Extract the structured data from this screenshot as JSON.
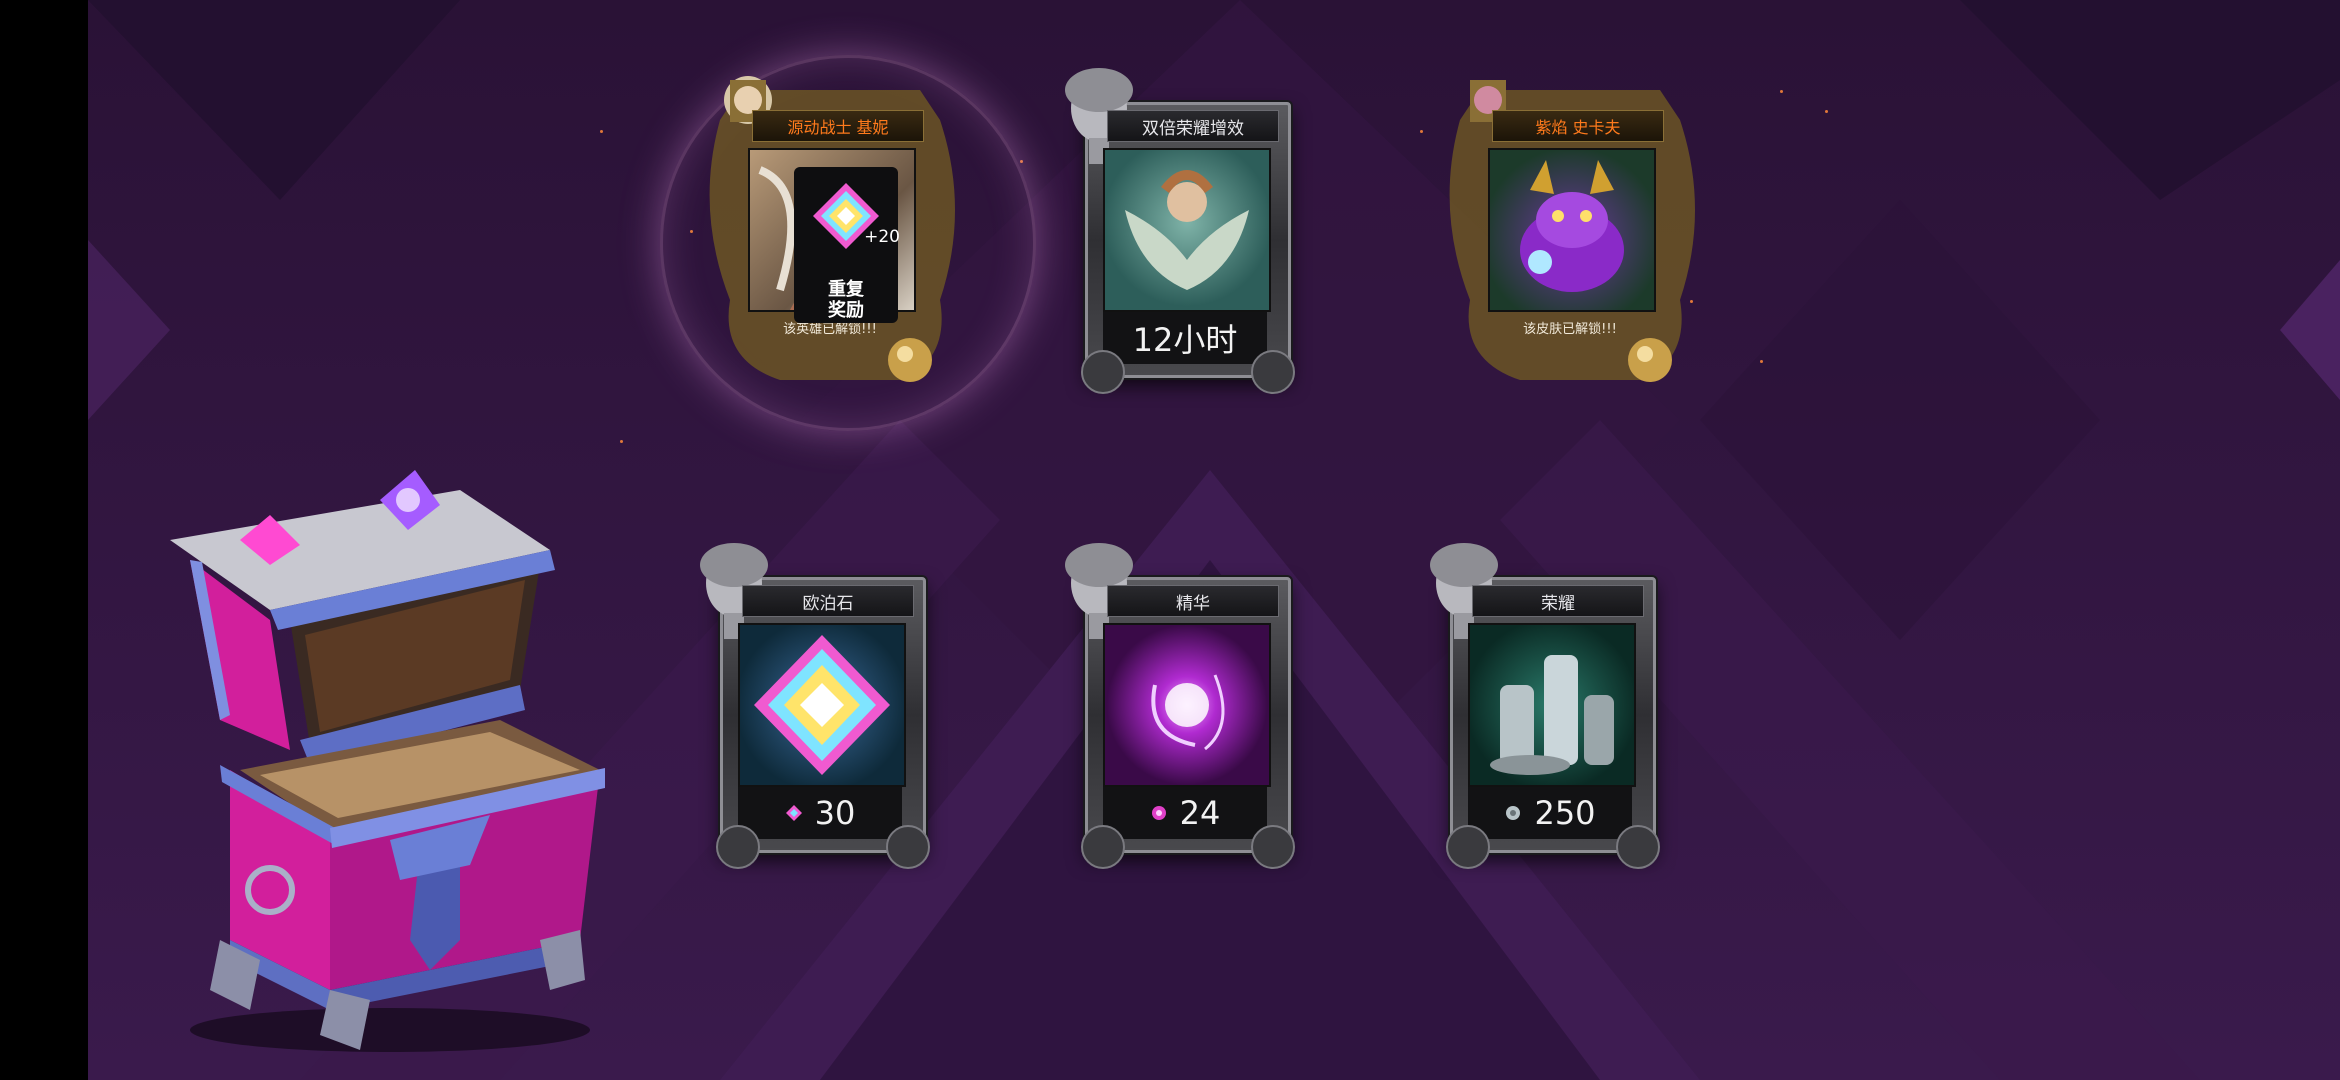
{
  "top_cards": [
    {
      "title": "源动战士 基妮",
      "status": "该英雄已解锁!!!",
      "badge_plus": "+20",
      "badge_line1": "重复",
      "badge_line2": "奖励"
    },
    {
      "title": "双倍荣耀增效",
      "value": "12小时"
    },
    {
      "title": "紫焰 史卡夫",
      "status": "该皮肤已解锁!!!"
    }
  ],
  "bottom_cards": [
    {
      "title": "欧泊石",
      "value": "30",
      "icon": "opal-gem-icon"
    },
    {
      "title": "精华",
      "value": "24",
      "icon": "essence-icon"
    },
    {
      "title": "荣耀",
      "value": "250",
      "icon": "glory-coin-icon"
    }
  ],
  "colors": {
    "background": "#2b1338",
    "title_orange": "#ff7a1c",
    "chest_pink": "#e02aa8",
    "chest_blue": "#5c6fc4"
  }
}
